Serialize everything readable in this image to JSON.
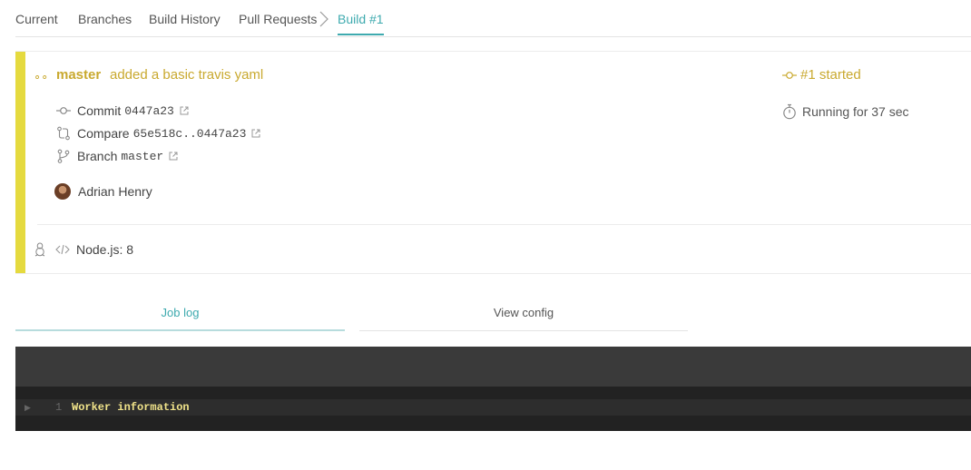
{
  "tabs": {
    "current": "Current",
    "branches": "Branches",
    "build_history": "Build History",
    "pull_requests": "Pull Requests",
    "build": "Build #1"
  },
  "build": {
    "branch": "master",
    "message": "added a basic travis yaml",
    "commit_label": "Commit",
    "commit_sha": "0447a23",
    "compare_label": "Compare",
    "compare_range": "65e518c..0447a23",
    "branch_label": "Branch",
    "branch_value": "master",
    "author": "Adrian Henry",
    "status": "#1 started",
    "duration": "Running for 37 sec",
    "env": "Node.js: 8",
    "accent_color": "#e5da3f",
    "status_color": "#c9a92f"
  },
  "log_tabs": {
    "job_log": "Job log",
    "view_config": "View config"
  },
  "log": {
    "lines": [
      {
        "number": "1",
        "text": "Worker information"
      }
    ]
  },
  "icons": [
    "chevron-right-icon",
    "infinity-icon",
    "commit-icon",
    "compare-icon",
    "branch-icon",
    "external-link-icon",
    "stopwatch-icon",
    "linux-icon",
    "code-icon",
    "expand-caret-icon"
  ]
}
